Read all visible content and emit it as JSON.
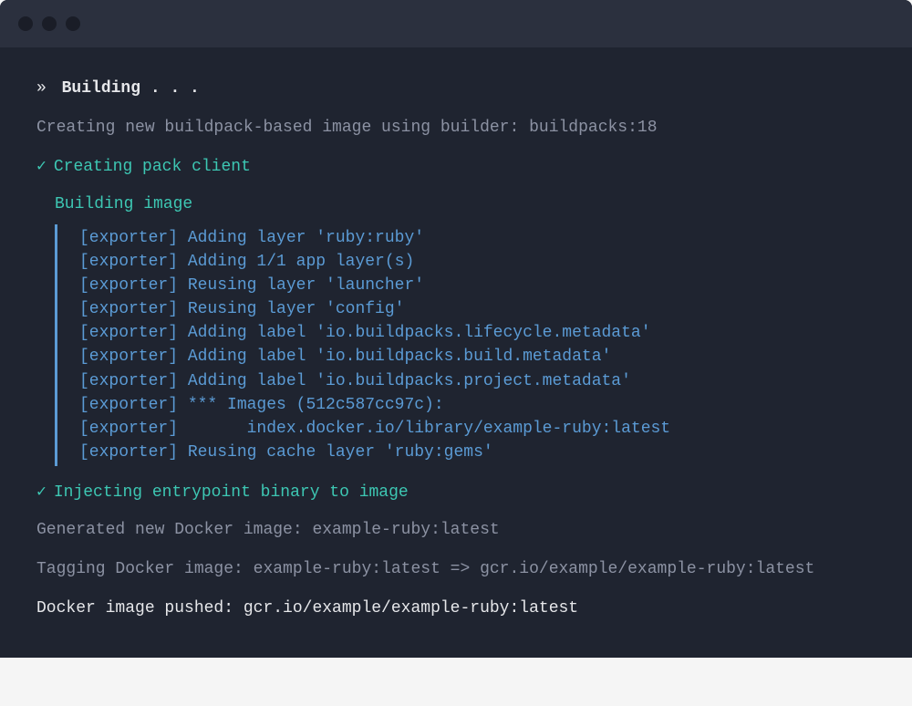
{
  "header": {
    "arrow": "»",
    "text": "Building . . ."
  },
  "creating_image_line": "Creating new buildpack-based image using builder: buildpacks:18",
  "step1": {
    "check": "✓",
    "text": "Creating pack client"
  },
  "building_image_label": "Building image",
  "exporter_lines": [
    "[exporter] Adding layer 'ruby:ruby'",
    "[exporter] Adding 1/1 app layer(s)",
    "[exporter] Reusing layer 'launcher'",
    "[exporter] Reusing layer 'config'",
    "[exporter] Adding label 'io.buildpacks.lifecycle.metadata'",
    "[exporter] Adding label 'io.buildpacks.build.metadata'",
    "[exporter] Adding label 'io.buildpacks.project.metadata'",
    "[exporter] *** Images (512c587cc97c):",
    "[exporter]       index.docker.io/library/example-ruby:latest",
    "[exporter] Reusing cache layer 'ruby:gems'"
  ],
  "step2": {
    "check": "✓",
    "text": "Injecting entrypoint binary to image"
  },
  "generated_line": "Generated new Docker image: example-ruby:latest",
  "tagging_line": "Tagging Docker image: example-ruby:latest => gcr.io/example/example-ruby:latest",
  "pushed_line": "Docker image pushed: gcr.io/example/example-ruby:latest"
}
